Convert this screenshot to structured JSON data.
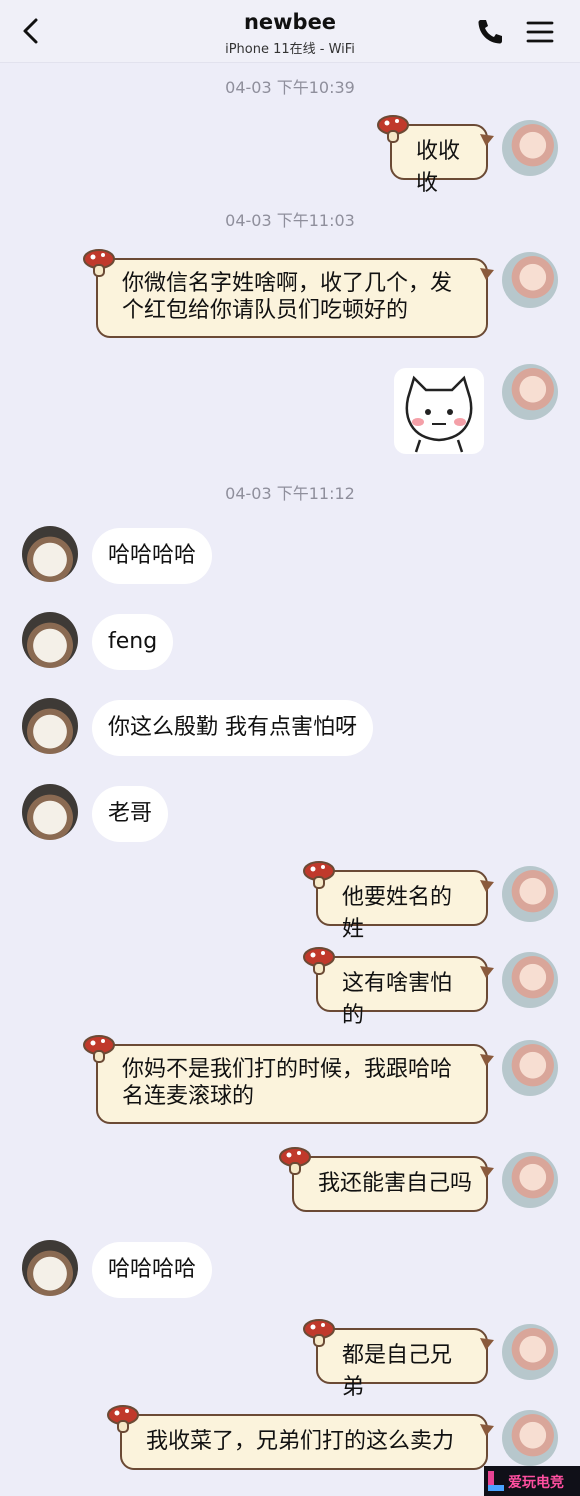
{
  "header": {
    "title": "newbee",
    "subtitle": "iPhone 11在线 - WiFi"
  },
  "timestamps": [
    "04-03 下午10:39",
    "04-03 下午11:03",
    "04-03 下午11:12"
  ],
  "messages": {
    "m1": "收收收",
    "m2_line1": "你微信名字姓啥啊，收了几个，发",
    "m2_line2": "个红包给你请队员们吃顿好的",
    "m3": "哈哈哈哈",
    "m4": "feng",
    "m5": "你这么殷勤 我有点害怕呀",
    "m6": "老哥",
    "m7": "他要姓名的姓",
    "m8": "这有啥害怕的",
    "m9_line1": "你妈不是我们打的时候，我跟哈哈",
    "m9_line2": "名连麦滚球的",
    "m10": "我还能害自己吗",
    "m11": "哈哈哈哈",
    "m12": "都是自己兄弟",
    "m13": "我收菜了，兄弟们打的这么卖力"
  },
  "watermark": {
    "text": "爱玩电竞"
  },
  "colors": {
    "background": "#ededf8",
    "bubble_right_fill": "#fbf3dc",
    "bubble_right_border": "#6b4a35",
    "bubble_left_fill": "#ffffff",
    "timestamp": "#8f8f9c"
  }
}
